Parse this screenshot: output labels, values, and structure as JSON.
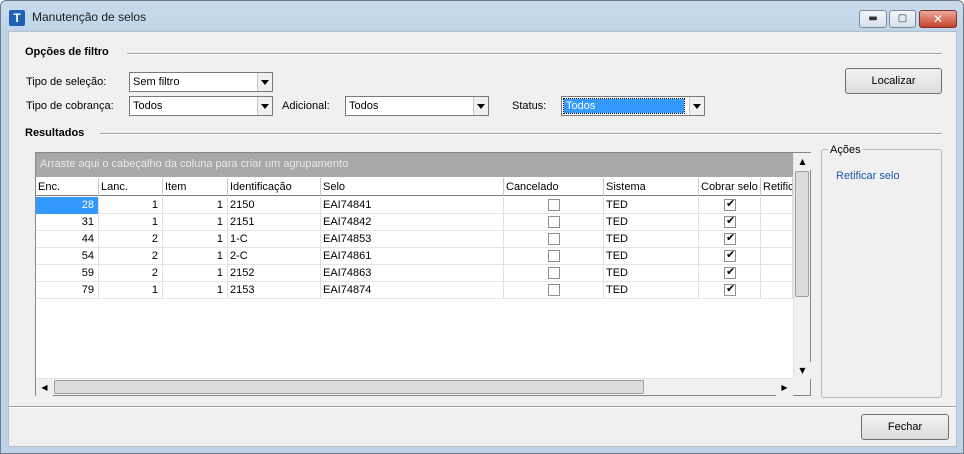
{
  "window": {
    "title": "Manutenção de selos",
    "icon_letter": "T",
    "controls": {
      "minimize": "▬",
      "maximize": "▢",
      "close": "✕"
    }
  },
  "filtro": {
    "title": "Opções de filtro",
    "tipo_selecao": {
      "label": "Tipo de seleção:",
      "value": "Sem filtro"
    },
    "tipo_cobranca": {
      "label": "Tipo de cobrança:",
      "value": "Todos"
    },
    "adicional": {
      "label": "Adicional:",
      "value": "Todos"
    },
    "status": {
      "label": "Status:",
      "value": "Todos"
    },
    "localizar_button": "Localizar"
  },
  "resultados": {
    "title": "Resultados",
    "group_panel_text": "Arraste aqui o cabeçalho da coluna para criar um agrupamento",
    "columns": [
      "Enc.",
      "Lanc.",
      "Item",
      "Identificação",
      "Selo",
      "Cancelado",
      "Sistema",
      "Cobrar selo",
      "Retifica"
    ],
    "rows": [
      {
        "enc": "28",
        "lanc": "1",
        "item": "1",
        "ident": "2150",
        "selo": "EAI74841",
        "cancelado": false,
        "sistema": "TED",
        "cobrar": true
      },
      {
        "enc": "31",
        "lanc": "1",
        "item": "1",
        "ident": "2151",
        "selo": "EAI74842",
        "cancelado": false,
        "sistema": "TED",
        "cobrar": true
      },
      {
        "enc": "44",
        "lanc": "2",
        "item": "1",
        "ident": "1-C",
        "selo": "EAI74853",
        "cancelado": false,
        "sistema": "TED",
        "cobrar": true
      },
      {
        "enc": "54",
        "lanc": "2",
        "item": "1",
        "ident": "2-C",
        "selo": "EAI74861",
        "cancelado": false,
        "sistema": "TED",
        "cobrar": true
      },
      {
        "enc": "59",
        "lanc": "2",
        "item": "1",
        "ident": "2152",
        "selo": "EAI74863",
        "cancelado": false,
        "sistema": "TED",
        "cobrar": true
      },
      {
        "enc": "79",
        "lanc": "1",
        "item": "1",
        "ident": "2153",
        "selo": "EAI74874",
        "cancelado": false,
        "sistema": "TED",
        "cobrar": true
      }
    ],
    "scroll": {
      "up": "▲",
      "down": "▼",
      "left": "◀",
      "right": "▶"
    }
  },
  "acoes": {
    "title": "Ações",
    "retificar": "Retificar selo"
  },
  "footer": {
    "fechar_button": "Fechar"
  }
}
